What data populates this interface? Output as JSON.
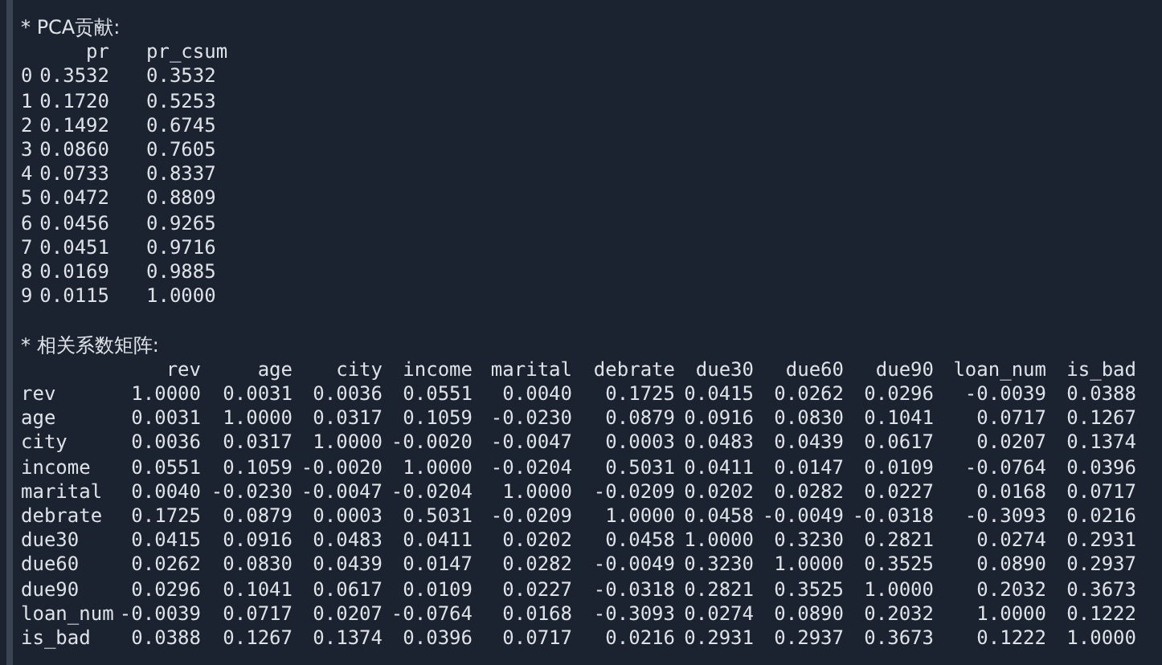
{
  "pca": {
    "title": "* PCA贡献:",
    "columns": [
      "pr",
      "pr_csum"
    ],
    "rows": [
      {
        "index": "0",
        "values": [
          "0.3532",
          "0.3532"
        ]
      },
      {
        "index": "1",
        "values": [
          "0.1720",
          "0.5253"
        ]
      },
      {
        "index": "2",
        "values": [
          "0.1492",
          "0.6745"
        ]
      },
      {
        "index": "3",
        "values": [
          "0.0860",
          "0.7605"
        ]
      },
      {
        "index": "4",
        "values": [
          "0.0733",
          "0.8337"
        ]
      },
      {
        "index": "5",
        "values": [
          "0.0472",
          "0.8809"
        ]
      },
      {
        "index": "6",
        "values": [
          "0.0456",
          "0.9265"
        ]
      },
      {
        "index": "7",
        "values": [
          "0.0451",
          "0.9716"
        ]
      },
      {
        "index": "8",
        "values": [
          "0.0169",
          "0.9885"
        ]
      },
      {
        "index": "9",
        "values": [
          "0.0115",
          "1.0000"
        ]
      }
    ]
  },
  "correlation": {
    "title": "* 相关系数矩阵:",
    "columns": [
      "rev",
      "age",
      "city",
      "income",
      "marital",
      "debrate",
      "due30",
      "due60",
      "due90",
      "loan_num",
      "is_bad"
    ],
    "rows": [
      {
        "label": "rev",
        "values": [
          "1.0000",
          "0.0031",
          "0.0036",
          "0.0551",
          "0.0040",
          "0.1725",
          "0.0415",
          "0.0262",
          "0.0296",
          "-0.0039",
          "0.0388"
        ]
      },
      {
        "label": "age",
        "values": [
          "0.0031",
          "1.0000",
          "0.0317",
          "0.1059",
          "-0.0230",
          "0.0879",
          "0.0916",
          "0.0830",
          "0.1041",
          "0.0717",
          "0.1267"
        ]
      },
      {
        "label": "city",
        "values": [
          "0.0036",
          "0.0317",
          "1.0000",
          "-0.0020",
          "-0.0047",
          "0.0003",
          "0.0483",
          "0.0439",
          "0.0617",
          "0.0207",
          "0.1374"
        ]
      },
      {
        "label": "income",
        "values": [
          "0.0551",
          "0.1059",
          "-0.0020",
          "1.0000",
          "-0.0204",
          "0.5031",
          "0.0411",
          "0.0147",
          "0.0109",
          "-0.0764",
          "0.0396"
        ]
      },
      {
        "label": "marital",
        "values": [
          "0.0040",
          "-0.0230",
          "-0.0047",
          "-0.0204",
          "1.0000",
          "-0.0209",
          "0.0202",
          "0.0282",
          "0.0227",
          "0.0168",
          "0.0717"
        ]
      },
      {
        "label": "debrate",
        "values": [
          "0.1725",
          "0.0879",
          "0.0003",
          "0.5031",
          "-0.0209",
          "1.0000",
          "0.0458",
          "-0.0049",
          "-0.0318",
          "-0.3093",
          "0.0216"
        ]
      },
      {
        "label": "due30",
        "values": [
          "0.0415",
          "0.0916",
          "0.0483",
          "0.0411",
          "0.0202",
          "0.0458",
          "1.0000",
          "0.3230",
          "0.2821",
          "0.0274",
          "0.2931"
        ]
      },
      {
        "label": "due60",
        "values": [
          "0.0262",
          "0.0830",
          "0.0439",
          "0.0147",
          "0.0282",
          "-0.0049",
          "0.3230",
          "1.0000",
          "0.3525",
          "0.0890",
          "0.2937"
        ]
      },
      {
        "label": "due90",
        "values": [
          "0.0296",
          "0.1041",
          "0.0617",
          "0.0109",
          "0.0227",
          "-0.0318",
          "0.2821",
          "0.3525",
          "1.0000",
          "0.2032",
          "0.3673"
        ]
      },
      {
        "label": "loan_num",
        "values": [
          "-0.0039",
          "0.0717",
          "0.0207",
          "-0.0764",
          "0.0168",
          "-0.3093",
          "0.0274",
          "0.0890",
          "0.2032",
          "1.0000",
          "0.1222"
        ]
      },
      {
        "label": "is_bad",
        "values": [
          "0.0388",
          "0.1267",
          "0.1374",
          "0.0396",
          "0.0717",
          "0.0216",
          "0.2931",
          "0.2937",
          "0.3673",
          "0.1222",
          "1.0000"
        ]
      }
    ]
  }
}
